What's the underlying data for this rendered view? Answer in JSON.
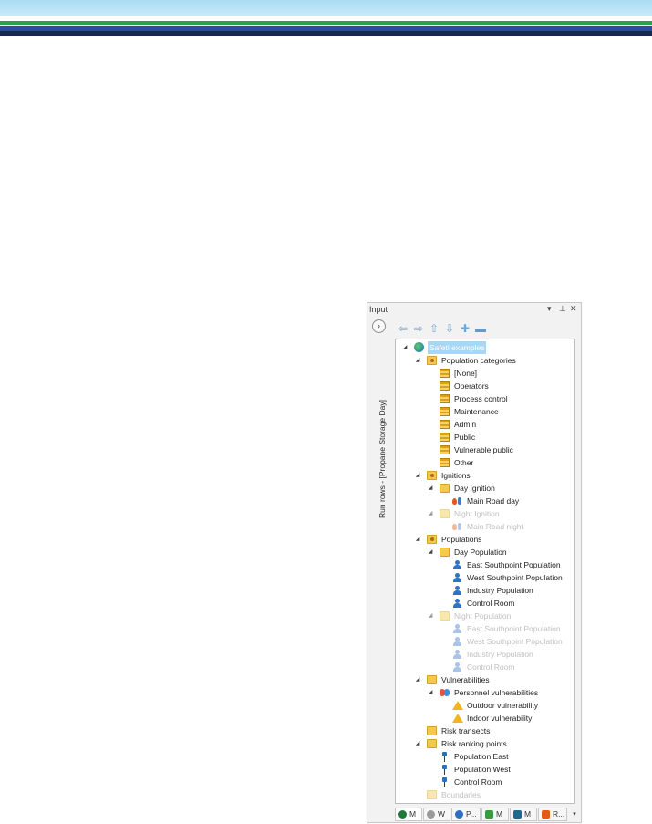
{
  "panel": {
    "title": "Input",
    "dropdown_glyph": "▾",
    "pin_glyph": "⊥",
    "close_glyph": "✕",
    "expand_glyph": "›",
    "run_rows_label": "Run rows - [Propane Storage Day]"
  },
  "toolbar": {
    "icons": [
      "back-arrow-icon",
      "forward-arrow-icon",
      "up-arrow-icon",
      "down-arrow-icon",
      "add-icon",
      "remove-icon"
    ]
  },
  "tree": {
    "expanded_glyph": "◢",
    "root": "Safeti examples",
    "population_categories": {
      "label": "Population categories",
      "items": [
        "[None]",
        "Operators",
        "Process control",
        "Maintenance",
        "Admin",
        "Public",
        "Vulnerable public",
        "Other"
      ]
    },
    "ignitions": {
      "label": "Ignitions",
      "day_label": "Day Ignition",
      "day_item": "Main Road day",
      "night_label": "Night Ignition",
      "night_item": "Main Road night"
    },
    "populations": {
      "label": "Populations",
      "day_label": "Day Population",
      "day_items": [
        "East Southpoint Population",
        "West Southpoint Population",
        "Industry Population",
        "Control Room"
      ],
      "night_label": "Night Population",
      "night_items": [
        "East Southpoint Population",
        "West Southpoint Population",
        "Industry Population",
        "Control Room"
      ]
    },
    "vulnerabilities": {
      "label": "Vulnerabilities",
      "personnel_label": "Personnel vulnerabilities",
      "items": [
        "Outdoor vulnerability",
        "Indoor vulnerability"
      ]
    },
    "risk_transects": "Risk transects",
    "risk_ranking": {
      "label": "Risk ranking points",
      "items": [
        "Population East",
        "Population West",
        "Control Room"
      ]
    },
    "boundaries": "Boundaries"
  },
  "tabs": [
    {
      "label": "M",
      "color": "#1f7a3a"
    },
    {
      "label": "W",
      "color": "#8a8a8a"
    },
    {
      "label": "P...",
      "color": "#2b6fc0"
    },
    {
      "label": "M",
      "color": "#3c9a3c"
    },
    {
      "label": "M",
      "color": "#1c6a8c"
    },
    {
      "label": "R...",
      "color": "#e05a1a"
    }
  ],
  "tabs_more_glyph": "▾"
}
